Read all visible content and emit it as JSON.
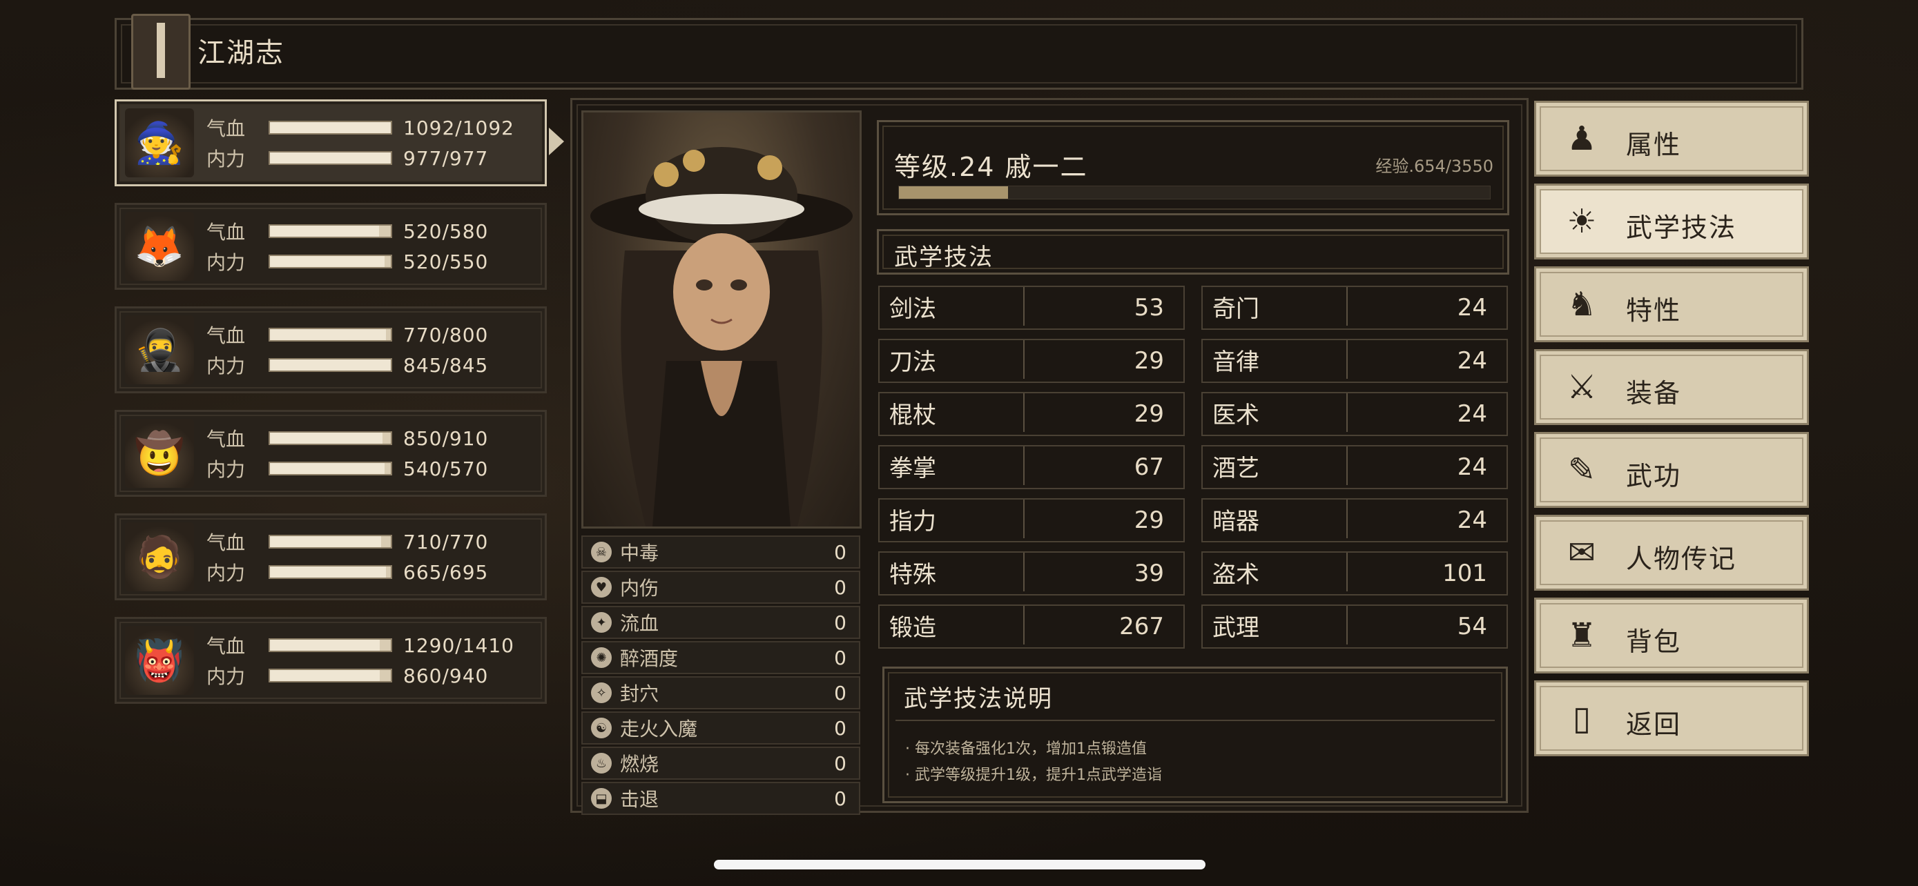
{
  "header": {
    "title": "江湖志"
  },
  "party": [
    {
      "avatar": "🧙",
      "hp_label": "气血",
      "hp": "1092/1092",
      "hp_frac": 1.0,
      "mp_label": "内力",
      "mp": "977/977",
      "mp_frac": 1.0,
      "active": true
    },
    {
      "avatar": "🦊",
      "hp_label": "气血",
      "hp": "520/580",
      "hp_frac": 0.9,
      "mp_label": "内力",
      "mp": "520/550",
      "mp_frac": 0.95
    },
    {
      "avatar": "🥷",
      "hp_label": "气血",
      "hp": "770/800",
      "hp_frac": 0.96,
      "mp_label": "内力",
      "mp": "845/845",
      "mp_frac": 1.0
    },
    {
      "avatar": "🤠",
      "hp_label": "气血",
      "hp": "850/910",
      "hp_frac": 0.93,
      "mp_label": "内力",
      "mp": "540/570",
      "mp_frac": 0.95
    },
    {
      "avatar": "🧔",
      "hp_label": "气血",
      "hp": "710/770",
      "hp_frac": 0.92,
      "mp_label": "内力",
      "mp": "665/695",
      "mp_frac": 0.96
    },
    {
      "avatar": "👹",
      "hp_label": "气血",
      "hp": "1290/1410",
      "hp_frac": 0.91,
      "mp_label": "内力",
      "mp": "860/940",
      "mp_frac": 0.91
    }
  ],
  "status_effects": [
    {
      "icon": "poison-icon",
      "glyph": "☠",
      "name": "中毒",
      "value": "0"
    },
    {
      "icon": "internal-injury-icon",
      "glyph": "♥",
      "name": "内伤",
      "value": "0"
    },
    {
      "icon": "bleed-icon",
      "glyph": "✦",
      "name": "流血",
      "value": "0"
    },
    {
      "icon": "drunk-icon",
      "glyph": "✺",
      "name": "醉酒度",
      "value": "0"
    },
    {
      "icon": "seal-acupoint-icon",
      "glyph": "✧",
      "name": "封穴",
      "value": "0"
    },
    {
      "icon": "qi-deviation-icon",
      "glyph": "☯",
      "name": "走火入魔",
      "value": "0"
    },
    {
      "icon": "burn-icon",
      "glyph": "♨",
      "name": "燃烧",
      "value": "0"
    },
    {
      "icon": "knockback-icon",
      "glyph": "⬓",
      "name": "击退",
      "value": "0"
    }
  ],
  "character": {
    "level_title": "等级.24 戚一二",
    "exp_text": "经验.654/3550",
    "exp_frac": 0.184
  },
  "skills_section": {
    "title": "武学技法"
  },
  "skills_left": [
    {
      "name": "剑法",
      "value": "53"
    },
    {
      "name": "刀法",
      "value": "29"
    },
    {
      "name": "棍杖",
      "value": "29"
    },
    {
      "name": "拳掌",
      "value": "67"
    },
    {
      "name": "指力",
      "value": "29"
    },
    {
      "name": "特殊",
      "value": "39"
    },
    {
      "name": "锻造",
      "value": "267"
    }
  ],
  "skills_right": [
    {
      "name": "奇门",
      "value": "24"
    },
    {
      "name": "音律",
      "value": "24"
    },
    {
      "name": "医术",
      "value": "24"
    },
    {
      "name": "酒艺",
      "value": "24"
    },
    {
      "name": "暗器",
      "value": "24"
    },
    {
      "name": "盗术",
      "value": "101"
    },
    {
      "name": "武理",
      "value": "54"
    }
  ],
  "description": {
    "title": "武学技法说明",
    "lines": [
      "· 每次装备强化1次，增加1点锻造值",
      "· 武学等级提升1级，提升1点武学造诣"
    ]
  },
  "menu": [
    {
      "label": "属性",
      "icon": "attribute-icon",
      "glyph": "♟"
    },
    {
      "label": "武学技法",
      "icon": "martial-skill-icon",
      "glyph": "☀",
      "active": true
    },
    {
      "label": "特性",
      "icon": "trait-icon",
      "glyph": "♞"
    },
    {
      "label": "装备",
      "icon": "sword-icon",
      "glyph": "⚔"
    },
    {
      "label": "武功",
      "icon": "manual-icon",
      "glyph": "✎"
    },
    {
      "label": "人物传记",
      "icon": "biography-icon",
      "glyph": "✉"
    },
    {
      "label": "背包",
      "icon": "bag-icon",
      "glyph": "♜"
    },
    {
      "label": "返回",
      "icon": "door-icon",
      "glyph": "▯"
    }
  ]
}
